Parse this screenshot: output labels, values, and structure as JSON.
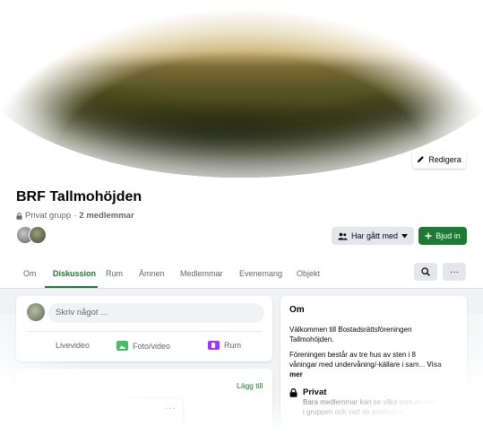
{
  "cover": {
    "edit_label": "Redigera"
  },
  "group": {
    "name": "BRF Tallmohöjden",
    "privacy": "Privat grupp",
    "separator": "·",
    "members": "2 medlemmar"
  },
  "actions": {
    "joined_label": "Har gått med",
    "invite_label": "Bjud in"
  },
  "tabs": [
    {
      "label": "Om"
    },
    {
      "label": "Diskussion"
    },
    {
      "label": "Rum"
    },
    {
      "label": "Ämnen"
    },
    {
      "label": "Medlemmar"
    },
    {
      "label": "Evenemang"
    },
    {
      "label": "Objekt"
    }
  ],
  "active_tab": "Diskussion",
  "composer": {
    "placeholder": "Skriv något ...",
    "actions": [
      {
        "label": "Livevideo"
      },
      {
        "label": "Foto/video"
      },
      {
        "label": "Rum"
      }
    ]
  },
  "feed": {
    "add_label": "Lägg till",
    "more_label": "···"
  },
  "about": {
    "title": "Om",
    "welcome": "Välkommen till Bostadsrättsföreningen Tallmohöjden.",
    "description": "Föreningen består av tre hus av sten i 8 våningar med undervåning/-källare i sam...",
    "see_more": "Visa mer",
    "private_title": "Privat",
    "private_desc": "Bara medlemmar kan se vilka som är med i gruppen och vad de publicerar."
  },
  "colors": {
    "accent": "#1b7a34",
    "background": "#f0f2f5",
    "text": "#050505",
    "muted": "#65676b"
  },
  "icons": [
    "pencil-icon",
    "lock-icon",
    "people-icon",
    "plus-icon",
    "search-icon",
    "more-icon",
    "photo-icon",
    "room-icon",
    "caret-down-icon"
  ]
}
